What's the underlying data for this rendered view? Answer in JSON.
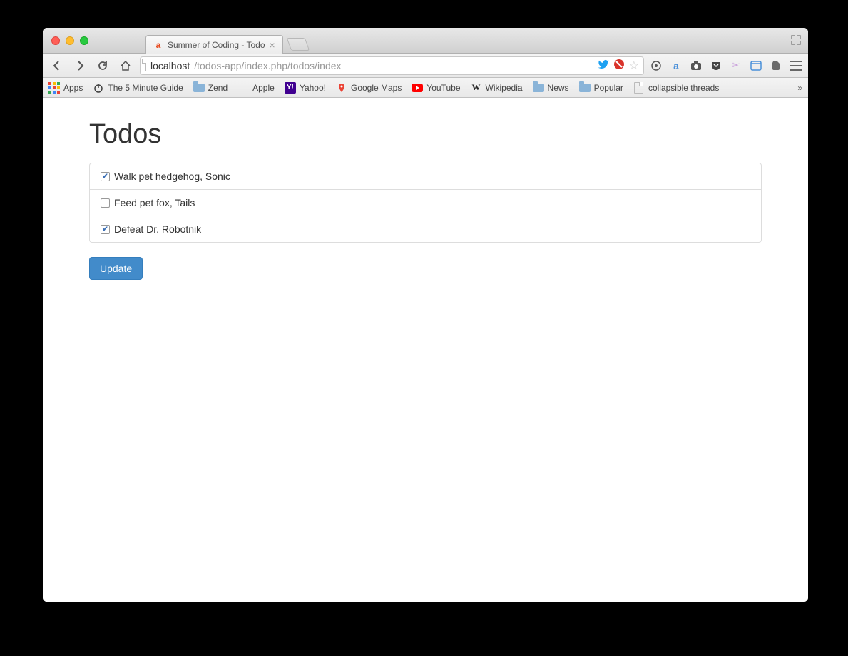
{
  "window": {
    "tab_title": "Summer of Coding - Todo"
  },
  "urlbar": {
    "host": "localhost",
    "path": "/todos-app/index.php/todos/index"
  },
  "bookmarks": {
    "apps": "Apps",
    "items": [
      "The 5 Minute Guide",
      "Zend",
      "Apple",
      "Yahoo!",
      "Google Maps",
      "YouTube",
      "Wikipedia",
      "News",
      "Popular",
      "collapsible threads"
    ]
  },
  "page": {
    "heading": "Todos",
    "todos": [
      {
        "label": "Walk pet hedgehog, Sonic",
        "checked": true
      },
      {
        "label": "Feed pet fox, Tails",
        "checked": false
      },
      {
        "label": "Defeat Dr. Robotnik",
        "checked": true
      }
    ],
    "update_button": "Update"
  }
}
